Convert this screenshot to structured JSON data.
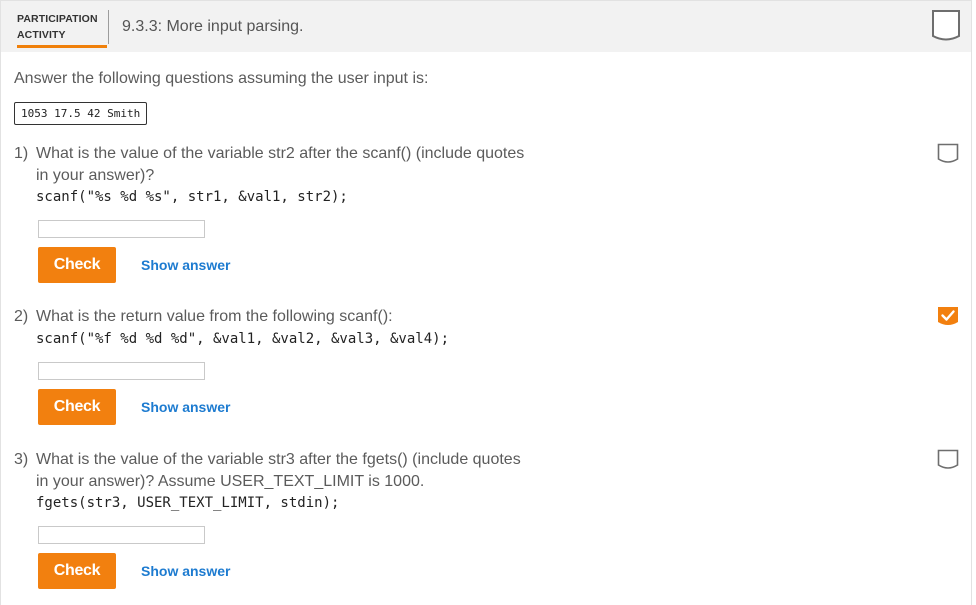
{
  "header": {
    "type_line1": "PARTICIPATION",
    "type_line2": "ACTIVITY",
    "title": "9.3.3: More input parsing.",
    "badge_icon": "activity-completion-badge-empty"
  },
  "intro_text": "Answer the following questions assuming the user input is:",
  "user_input": "1053 17.5 42 Smith",
  "questions": [
    {
      "number": "1)",
      "text": "What is the value of the variable str2 after the scanf() (include quotes in your answer)?",
      "code": "scanf(\"%s %d %s\", str1, &val1, str2);",
      "answer_value": "",
      "check_label": "Check",
      "show_answer_label": "Show answer",
      "status": "incomplete"
    },
    {
      "number": "2)",
      "text": "What is the return value from the following scanf():",
      "code": "scanf(\"%f %d %d %d\", &val1, &val2, &val3, &val4);",
      "answer_value": "",
      "check_label": "Check",
      "show_answer_label": "Show answer",
      "status": "complete"
    },
    {
      "number": "3)",
      "text": "What is the value of the variable str3 after the fgets() (include quotes in your answer)? Assume USER_TEXT_LIMIT is 1000.",
      "code": "fgets(str3, USER_TEXT_LIMIT, stdin);",
      "answer_value": "",
      "check_label": "Check",
      "show_answer_label": "Show answer",
      "status": "incomplete"
    }
  ],
  "colors": {
    "accent_orange": "#f2800f",
    "link_blue": "#1d7bd0",
    "header_bg": "#f2f2f2",
    "badge_gray": "#6e6e6e"
  }
}
